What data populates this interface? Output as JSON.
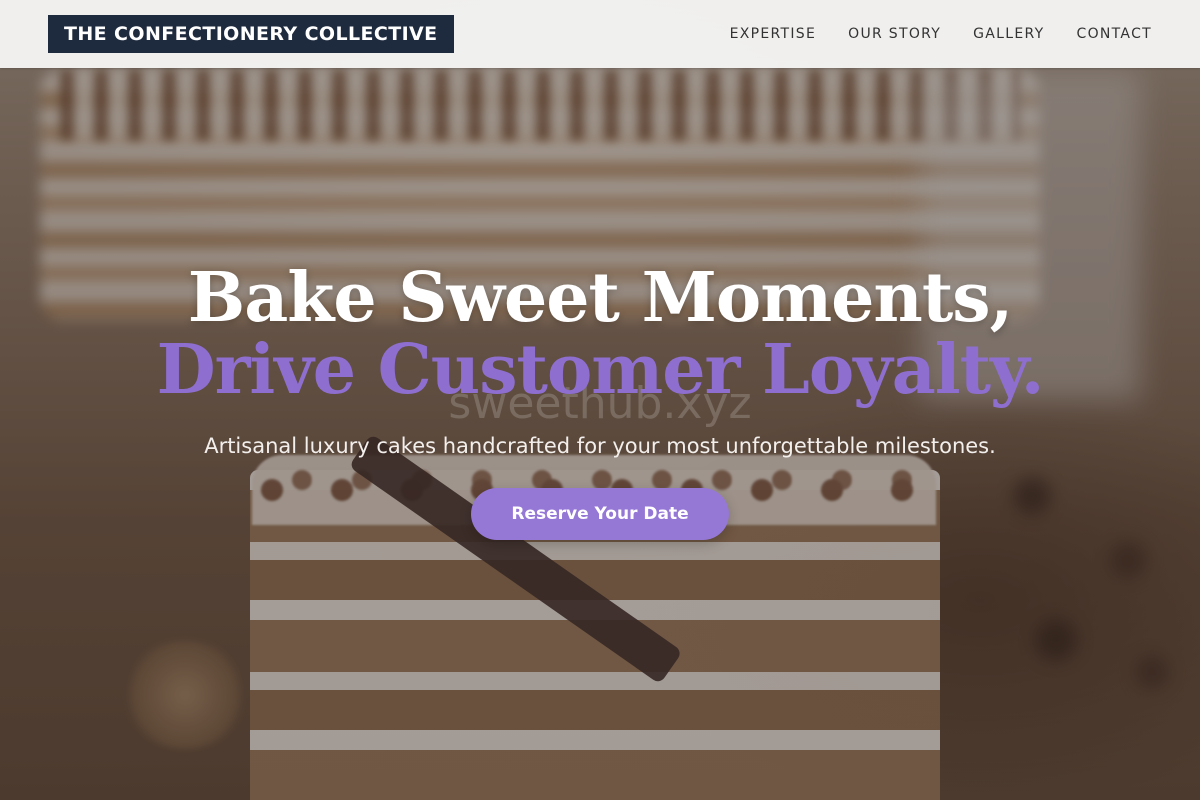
{
  "header": {
    "logo_text": "THE CONFECTIONERY COLLECTIVE",
    "nav": [
      {
        "label": "EXPERTISE"
      },
      {
        "label": "OUR STORY"
      },
      {
        "label": "GALLERY"
      },
      {
        "label": "CONTACT"
      }
    ]
  },
  "hero": {
    "headline_line1": "Bake Sweet Moments,",
    "headline_line2": "Drive Customer Loyalty.",
    "subtitle": "Artisanal luxury cakes handcrafted for your most unforgettable milestones.",
    "cta_label": "Reserve Your Date",
    "watermark": "sweethub.xyz"
  },
  "colors": {
    "logo_bg": "#1e2a3e",
    "accent": "#9577d6",
    "headline_accent": "#8e6fd0",
    "header_bg": "#f5f5f4"
  }
}
